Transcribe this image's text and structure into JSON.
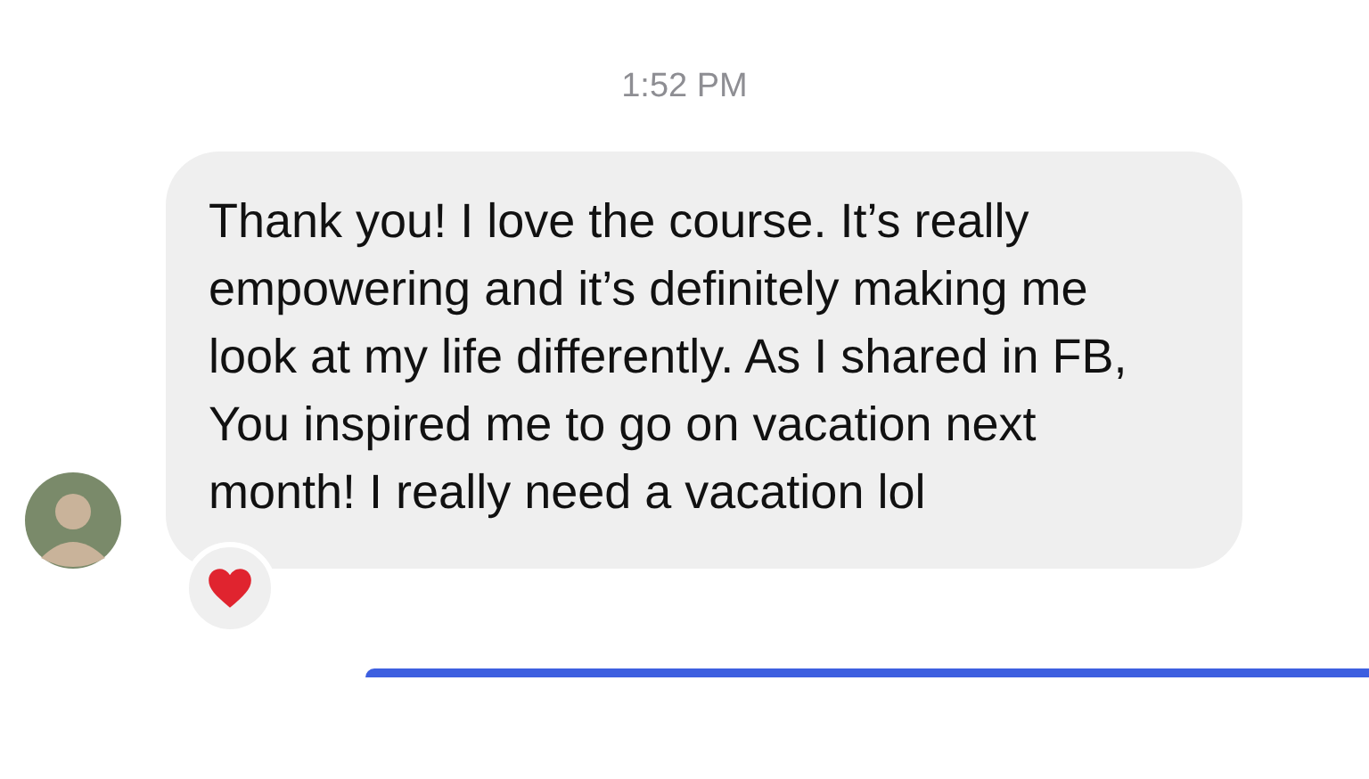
{
  "timestamp": "1:52 PM",
  "messages": [
    {
      "kind": "received",
      "text": "Thank you! I love the course. It’s really empowering and it’s definitely making me look at my life differently. As I shared in FB, You inspired me to go on vacation next month! I really need a vacation lol",
      "heart_reaction": true
    },
    {
      "kind": "sent"
    }
  ]
}
